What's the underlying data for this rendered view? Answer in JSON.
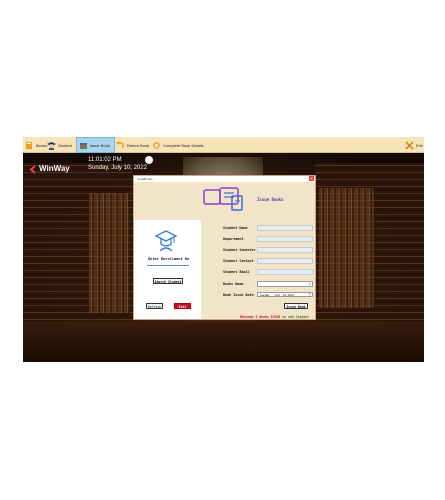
{
  "toolbar": {
    "books": "Books",
    "student": "Student",
    "issue_book": "Issue Book",
    "return_book": "Return Book",
    "complete_details": "Complete Book Details",
    "exit": "Exit"
  },
  "logo": {
    "text": "WinWay"
  },
  "clock": {
    "time": "11:01:02 PM",
    "date": "Sunday, July 10, 2022"
  },
  "dialog": {
    "title": "IssueBooks",
    "header_title": "Issue Books",
    "enroll_label": "Enter Enrollment No",
    "search_button": "Search Student",
    "refresh_button": "Refresh",
    "exit_button": "Exit",
    "fields": {
      "student_name": "Student Name",
      "department": "Department",
      "semester": "Student Semester",
      "contact": "Student Contact",
      "email": "Student Email",
      "book_name": "Books Name",
      "issue_date": "Book Issue Date"
    },
    "issue_date_value": "Sunday  ,    July    10, 2022",
    "issue_button": "Issue Book",
    "max_note_part1": "Maximum 3 Books ISSUE",
    "max_note_part2": " to one Student"
  },
  "colors": {
    "toolbar_bg": "#f6e3b8",
    "dialog_body": "#f2e4c9",
    "header_title": "#4b3aa6",
    "exit_button": "#c8102e",
    "max_note_red": "#c8102e",
    "max_note_green": "#2a7a2a"
  }
}
